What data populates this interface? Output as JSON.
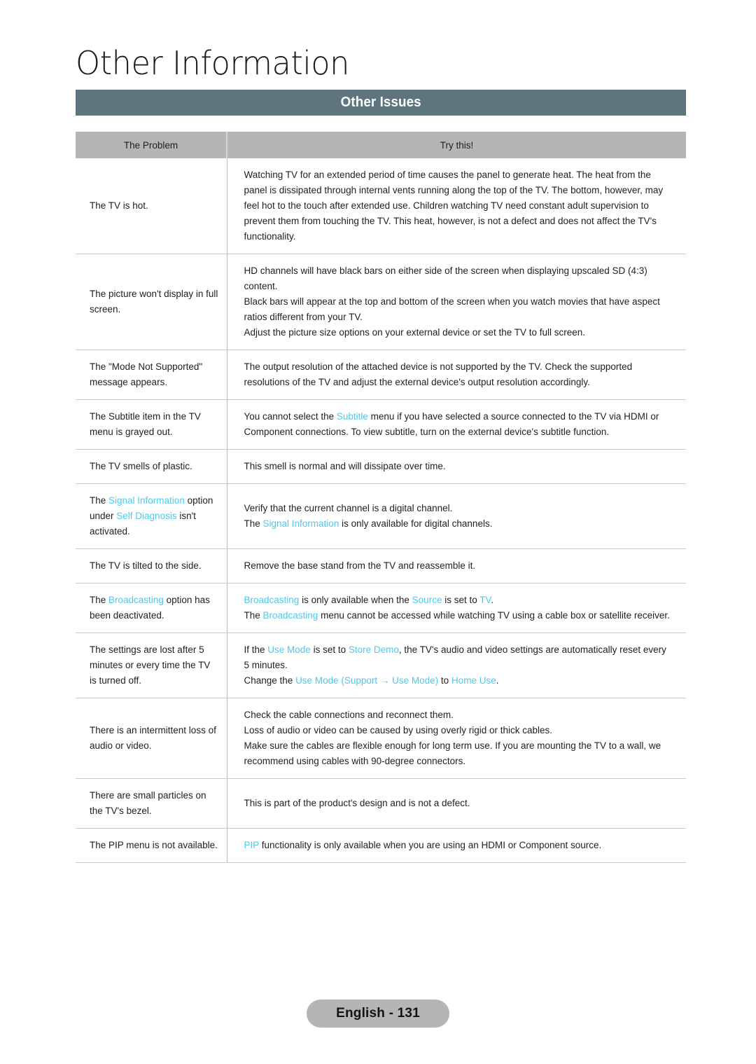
{
  "chapter": {
    "title": "Other Information"
  },
  "section": {
    "title": "Other Issues",
    "bar_color": "#5f757e"
  },
  "table": {
    "headers": {
      "problem": "The Problem",
      "try_this": "Try this!"
    },
    "header_bg": "#b5b5b5",
    "link_color": "#4ec8ee",
    "rows": [
      {
        "problem_html": "The TV is hot.",
        "try_html": "Watching TV for an extended period of time causes the panel to generate heat. The heat from the panel is dissipated through internal vents running along the top of the TV. The bottom, however, may feel hot to the touch after extended use. Children watching TV need constant adult supervision to prevent them from touching the TV. This heat, however, is not a defect and does not affect the TV's functionality."
      },
      {
        "problem_html": "The picture won't display in full screen.",
        "try_html": "<span class=\"cell-line\">HD channels will have black bars on either side of the screen when displaying upscaled SD (4:3) content.</span><span class=\"cell-line\">Black bars will appear at the top and bottom of the screen when you watch movies that have aspect ratios different from your TV.</span><span class=\"cell-line\">Adjust the picture size options on your external device or set the TV to full screen.</span>"
      },
      {
        "problem_html": "The \"Mode Not Supported\" message appears.",
        "try_html": "The output resolution of the attached device is not supported by the TV. Check the supported resolutions of the TV and adjust the external device's output resolution accordingly."
      },
      {
        "problem_html": "The Subtitle item in the TV menu is grayed out.",
        "try_html": "You cannot select the <span class=\"lnk\">Subtitle</span> menu if you have selected a source connected to the TV via HDMI or Component connections. To view subtitle, turn on the external device's subtitle function."
      },
      {
        "problem_html": "The TV smells of plastic.",
        "try_html": "This smell is normal and will dissipate over time."
      },
      {
        "problem_html": "The <span class=\"lnk\">Signal Information</span> option under <span class=\"lnk\">Self Diagnosis</span> isn't activated.",
        "try_html": "<span class=\"cell-line\">Verify that the current channel is a digital channel.</span><span class=\"cell-line\">The <span class=\"lnk\">Signal Information</span> is only available for digital channels.</span>"
      },
      {
        "problem_html": "The TV is tilted to the side.",
        "try_html": "Remove the base stand from the TV and reassemble it."
      },
      {
        "problem_html": "The <span class=\"lnk\">Broadcasting</span> option has been deactivated.",
        "try_html": "<span class=\"cell-line\"><span class=\"lnk\">Broadcasting</span> is only available when the <span class=\"lnk\">Source</span> is set to <span class=\"lnk\">TV</span>.</span><span class=\"cell-line\">The <span class=\"lnk\">Broadcasting</span> menu cannot be accessed while watching TV using a cable box or satellite receiver.</span>"
      },
      {
        "problem_html": "The settings are lost after 5 minutes or every time the TV is turned off.",
        "try_html": "<span class=\"cell-line\">If the <span class=\"lnk\">Use Mode</span> is set to <span class=\"lnk\">Store Demo</span>, the TV's audio and video settings are automatically reset every 5 minutes.</span><span class=\"cell-line\">Change the <span class=\"lnk\">Use Mode</span> <span class=\"lnk\">(Support &#8594; Use Mode)</span> to <span class=\"lnk\">Home Use</span>.</span>"
      },
      {
        "problem_html": "There is an intermittent loss of audio or video.",
        "try_html": "<span class=\"cell-line\">Check the cable connections and reconnect them.</span><span class=\"cell-line\">Loss of audio or video can be caused by using overly rigid or thick cables.</span><span class=\"cell-line\">Make sure the cables are flexible enough for long term use. If you are mounting the TV to a wall, we recommend using cables with 90-degree connectors.</span>"
      },
      {
        "problem_html": "There are small particles on the TV's bezel.",
        "try_html": "This is part of the product's design and is not a defect."
      },
      {
        "problem_html": "The PIP menu is not available.",
        "try_html": "<span class=\"lnk\">PIP</span> functionality is only available when you are using an HDMI or Component source."
      }
    ]
  },
  "footer": {
    "page_label": "English - 131"
  }
}
